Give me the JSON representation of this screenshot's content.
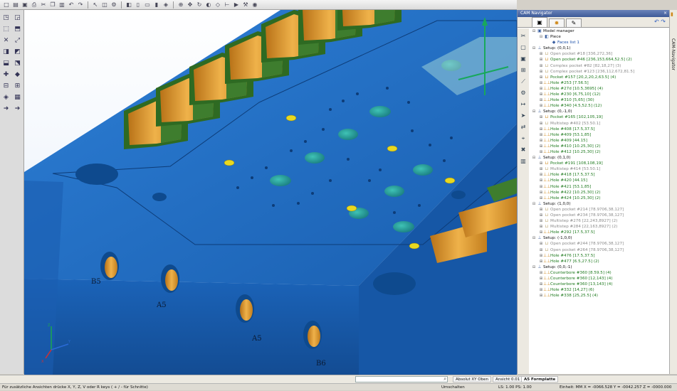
{
  "app": {
    "colors": {
      "part_blue": "#1f6fc9",
      "pocket_orange": "#d9951e",
      "wall_green": "#3e7d2e",
      "hole_teal": "#2a9b9b",
      "hole_yellow": "#e8d820",
      "panel_header": "#3e5b98"
    }
  },
  "toolbar": {
    "icons": [
      "new-icon",
      "open-icon",
      "save-icon",
      "print-icon",
      "cut-icon",
      "copy-icon",
      "paste-icon",
      "undo-icon",
      "redo-icon",
      "select-icon",
      "layer-icon",
      "settings-icon",
      "box-view-icon",
      "front-view-icon",
      "top-view-icon",
      "side-view-icon",
      "iso-view-icon",
      "zoom-icon",
      "pan-icon",
      "rotate-icon",
      "shade-icon",
      "wireframe-icon",
      "measure-icon",
      "sim-icon",
      "tool-icon",
      "cam-icon"
    ]
  },
  "cam_navigator": {
    "title": "CAM Navigator",
    "close_glyph": "×",
    "undo_glyph": "↶",
    "redo_glyph": "↷",
    "tabs": [
      {
        "icon": "model-manager-icon",
        "active": true
      },
      {
        "icon": "gear-icon",
        "active": false
      },
      {
        "icon": "tool-icon",
        "active": false
      }
    ],
    "side_strip_label": "CAM-Navigator"
  },
  "tree": [
    {
      "label": "Model manager",
      "level": 1,
      "style": "black",
      "icon": "cube-icon",
      "exp": "⊟"
    },
    {
      "label": "Piece",
      "level": 2,
      "style": "black",
      "icon": "part-icon",
      "exp": "⊟"
    },
    {
      "label": "Faces list 1",
      "level": 3,
      "style": "blue",
      "icon": "faces-icon",
      "exp": ""
    },
    {
      "label": "Setup: (0,0,1)",
      "level": 1,
      "style": "black",
      "icon": "setup-icon",
      "exp": "⊟"
    },
    {
      "label": "Open pocket #18 [336,272,36]",
      "level": 2,
      "style": "gray",
      "icon": "pocket-icon",
      "exp": "⊞"
    },
    {
      "label": "Open pocket #46 [236,153,664,52.5] (2)",
      "level": 2,
      "style": "green",
      "icon": "pocket-icon",
      "exp": "⊞"
    },
    {
      "label": "Complex pocket #82 [82,18,27] (3)",
      "level": 2,
      "style": "gray",
      "icon": "pocket-icon",
      "exp": "⊞"
    },
    {
      "label": "Complex pocket #123 [236,112,672,81.5]",
      "level": 2,
      "style": "gray",
      "icon": "pocket-icon",
      "exp": "⊞"
    },
    {
      "label": "Pocket #157 [20,2,20,2,63.5] (4)",
      "level": 2,
      "style": "green",
      "icon": "pocket-icon",
      "exp": "⊞"
    },
    {
      "label": "Hole #253 [7.56.5]",
      "level": 2,
      "style": "green",
      "icon": "hole-icon",
      "exp": "⊞"
    },
    {
      "label": "Hole #27d [10.5,3695] (4)",
      "level": 2,
      "style": "green",
      "icon": "hole-icon",
      "exp": "⊞"
    },
    {
      "label": "Hole #230 [6,75,10] (12)",
      "level": 2,
      "style": "green",
      "icon": "hole-icon",
      "exp": "⊞"
    },
    {
      "label": "Hole #310 [5,65] (30)",
      "level": 2,
      "style": "green",
      "icon": "hole-icon",
      "exp": "⊞"
    },
    {
      "label": "Hole #340 [4.5,52.5] (12)",
      "level": 2,
      "style": "green",
      "icon": "hole-icon",
      "exp": "⊞"
    },
    {
      "label": "Setup: (0,-1,0)",
      "level": 1,
      "style": "black",
      "icon": "setup-icon",
      "exp": "⊟"
    },
    {
      "label": "Pocket #165 [102,105,19]",
      "level": 2,
      "style": "green",
      "icon": "pocket-icon",
      "exp": "⊞"
    },
    {
      "label": "Multistep #402 [53.50.1]",
      "level": 2,
      "style": "gray",
      "icon": "pocket-icon",
      "exp": "⊞"
    },
    {
      "label": "Hole #408 [17.5,37.5]",
      "level": 2,
      "style": "green",
      "icon": "hole-icon",
      "exp": "⊞"
    },
    {
      "label": "Hole #409 [53.1,85]",
      "level": 2,
      "style": "green",
      "icon": "hole-icon",
      "exp": "⊞"
    },
    {
      "label": "Hole #409 [44.15]",
      "level": 2,
      "style": "green",
      "icon": "hole-icon",
      "exp": "⊞"
    },
    {
      "label": "Hole #410 [10.25,30] (2)",
      "level": 2,
      "style": "green",
      "icon": "hole-icon",
      "exp": "⊞"
    },
    {
      "label": "Hole #412 [10.25,30] (2)",
      "level": 2,
      "style": "green",
      "icon": "hole-icon",
      "exp": "⊞"
    },
    {
      "label": "Setup: (0,1,0)",
      "level": 1,
      "style": "black",
      "icon": "setup-icon",
      "exp": "⊟"
    },
    {
      "label": "Pocket #191 [108,108,19]",
      "level": 2,
      "style": "green",
      "icon": "pocket-icon",
      "exp": "⊞"
    },
    {
      "label": "Multistep #414 [53.50.1]",
      "level": 2,
      "style": "gray",
      "icon": "pocket-icon",
      "exp": "⊞"
    },
    {
      "label": "Hole #418 [17.5,37.5]",
      "level": 2,
      "style": "green",
      "icon": "hole-icon",
      "exp": "⊞"
    },
    {
      "label": "Hole #420 [44.15]",
      "level": 2,
      "style": "green",
      "icon": "hole-icon",
      "exp": "⊞"
    },
    {
      "label": "Hole #421 [53.1,85]",
      "level": 2,
      "style": "green",
      "icon": "hole-icon",
      "exp": "⊞"
    },
    {
      "label": "Hole #422 [10.25,30] (2)",
      "level": 2,
      "style": "green",
      "icon": "hole-icon",
      "exp": "⊞"
    },
    {
      "label": "Hole #424 [10.25,30] (2)",
      "level": 2,
      "style": "green",
      "icon": "hole-icon",
      "exp": "⊞"
    },
    {
      "label": "Setup: (1,0,0)",
      "level": 1,
      "style": "black",
      "icon": "setup-icon",
      "exp": "⊟"
    },
    {
      "label": "Open pocket #214 [78.9706,38,127]",
      "level": 2,
      "style": "gray",
      "icon": "pocket-icon",
      "exp": "⊞"
    },
    {
      "label": "Open pocket #234 [78.9706,38,127]",
      "level": 2,
      "style": "gray",
      "icon": "pocket-icon",
      "exp": "⊞"
    },
    {
      "label": "Multistep #276 [22,243,8927] (2)",
      "level": 2,
      "style": "gray",
      "icon": "pocket-icon",
      "exp": "⊞"
    },
    {
      "label": "Multistep #284 [22,163,8927] (2)",
      "level": 2,
      "style": "gray",
      "icon": "pocket-icon",
      "exp": "⊞"
    },
    {
      "label": "Hole #292 [17.5,37.5]",
      "level": 2,
      "style": "green",
      "icon": "hole-icon",
      "exp": "⊞"
    },
    {
      "label": "Setup: (-1,0,0)",
      "level": 1,
      "style": "black",
      "icon": "setup-icon",
      "exp": "⊟"
    },
    {
      "label": "Open pocket #244 [78.9706,38,127]",
      "level": 2,
      "style": "gray",
      "icon": "pocket-icon",
      "exp": "⊞"
    },
    {
      "label": "Open pocket #264 [78.9706,38,127]",
      "level": 2,
      "style": "gray",
      "icon": "pocket-icon",
      "exp": "⊞"
    },
    {
      "label": "Hole #476 [17.5,37.5]",
      "level": 2,
      "style": "green",
      "icon": "hole-icon",
      "exp": "⊞"
    },
    {
      "label": "Hole #477 [6.5,27.5] (2)",
      "level": 2,
      "style": "green",
      "icon": "hole-icon",
      "exp": "⊞"
    },
    {
      "label": "Setup: (0,0,-1)",
      "level": 1,
      "style": "black",
      "icon": "setup-icon",
      "exp": "⊟"
    },
    {
      "label": "Counterbore #360 [8.59.5] (4)",
      "level": 2,
      "style": "green",
      "icon": "hole-icon",
      "exp": "⊞"
    },
    {
      "label": "Counterbore #360 [12,143] (4)",
      "level": 2,
      "style": "green",
      "icon": "hole-icon",
      "exp": "⊞"
    },
    {
      "label": "Counterbore #360 [13,143] (4)",
      "level": 2,
      "style": "green",
      "icon": "hole-icon",
      "exp": "⊞"
    },
    {
      "label": "Hole #332 [14,27] (6)",
      "level": 2,
      "style": "green",
      "icon": "hole-icon",
      "exp": "⊞"
    },
    {
      "label": "Hole #338 [25,25.5] (4)",
      "level": 2,
      "style": "green",
      "icon": "hole-icon",
      "exp": "⊞"
    }
  ],
  "viewport": {
    "hole_labels": [
      "B5",
      "A5",
      "A5",
      "B6"
    ],
    "axis_labels": {
      "x": "X",
      "y": "Y",
      "z": "Z"
    }
  },
  "infobar": {
    "search_value": "",
    "cells": [
      "Absolut XY Oben",
      "Ansicht 0.01",
      "A5 Formplatte"
    ]
  },
  "status": {
    "hint": "Für zusätzliche Ansichten drücke X, Y, Z, V oder R keys ( + / - für Schnitte)",
    "mode": "Umschalten",
    "ls_ps": "LS: 1.00 PS: 1.00",
    "unit": "Einheit: MM",
    "coords": "X = -0066.528 Y = -0042.257 Z = -0000.000"
  }
}
